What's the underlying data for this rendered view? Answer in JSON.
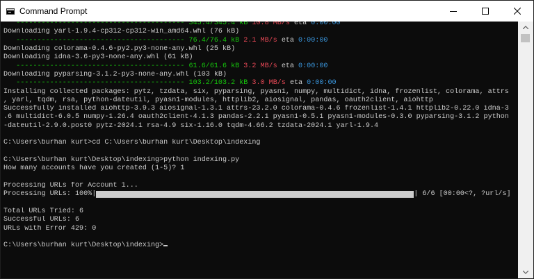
{
  "window": {
    "title": "Command Prompt",
    "icon": "terminal-icon",
    "controls": [
      "minimize-icon",
      "maximize-icon",
      "close-icon"
    ]
  },
  "colors": {
    "background": "#0c0c0c",
    "text": "#cccccc",
    "progress_green": "#16c60c",
    "speed_red": "#e74856",
    "eta_cyan": "#3a96dd"
  },
  "console": {
    "lines": [
      {
        "kind": "progress",
        "bar": "---------------------------------------- ",
        "amount": "345.4/345.4 kB",
        "speed": "10.8 MB/s",
        "eta_label": "eta",
        "eta": "0:00:00"
      },
      {
        "kind": "text",
        "text": "Downloading yarl-1.9.4-cp312-cp312-win_amd64.whl (76 kB)"
      },
      {
        "kind": "progress",
        "bar": "---------------------------------------- ",
        "amount": "76.4/76.4 kB",
        "speed": "2.1 MB/s",
        "eta_label": "eta",
        "eta": "0:00:00"
      },
      {
        "kind": "text",
        "text": "Downloading colorama-0.4.6-py2.py3-none-any.whl (25 kB)"
      },
      {
        "kind": "text",
        "text": "Downloading idna-3.6-py3-none-any.whl (61 kB)"
      },
      {
        "kind": "progress",
        "bar": "---------------------------------------- ",
        "amount": "61.6/61.6 kB",
        "speed": "3.2 MB/s",
        "eta_label": "eta",
        "eta": "0:00:00"
      },
      {
        "kind": "text",
        "text": "Downloading pyparsing-3.1.2-py3-none-any.whl (103 kB)"
      },
      {
        "kind": "progress",
        "bar": "---------------------------------------- ",
        "amount": "103.2/103.2 kB",
        "speed": "3.0 MB/s",
        "eta_label": "eta",
        "eta": "0:00:00"
      },
      {
        "kind": "text",
        "text": "Installing collected packages: pytz, tzdata, six, pyparsing, pyasn1, numpy, multidict, idna, frozenlist, colorama, attrs"
      },
      {
        "kind": "text",
        "text": ", yarl, tqdm, rsa, python-dateutil, pyasn1-modules, httplib2, aiosignal, pandas, oauth2client, aiohttp"
      },
      {
        "kind": "text",
        "text": "Successfully installed aiohttp-3.9.3 aiosignal-1.3.1 attrs-23.2.0 colorama-0.4.6 frozenlist-1.4.1 httplib2-0.22.0 idna-3"
      },
      {
        "kind": "text",
        "text": ".6 multidict-6.0.5 numpy-1.26.4 oauth2client-4.1.3 pandas-2.2.1 pyasn1-0.5.1 pyasn1-modules-0.3.0 pyparsing-3.1.2 python"
      },
      {
        "kind": "text",
        "text": "-dateutil-2.9.0.post0 pytz-2024.1 rsa-4.9 six-1.16.0 tqdm-4.66.2 tzdata-2024.1 yarl-1.9.4"
      },
      {
        "kind": "text",
        "text": ""
      },
      {
        "kind": "text",
        "text": "C:\\Users\\burhan kurt>cd C:\\Users\\burhan kurt\\Desktop\\indexing"
      },
      {
        "kind": "text",
        "text": ""
      },
      {
        "kind": "text",
        "text": "C:\\Users\\burhan kurt\\Desktop\\indexing>python indexing.py"
      },
      {
        "kind": "text",
        "text": "How many accounts have you created (1-5)? 1"
      },
      {
        "kind": "text",
        "text": ""
      },
      {
        "kind": "text",
        "text": "Processing URLs for Account 1..."
      },
      {
        "kind": "bar",
        "label": "Processing URLs: 100%|",
        "fraction": 1.0,
        "suffix": "| 6/6 [00:00<?, ?url/s]"
      },
      {
        "kind": "text",
        "text": ""
      },
      {
        "kind": "text",
        "text": "Total URLs Tried: 6"
      },
      {
        "kind": "text",
        "text": "Successful URLs: 6"
      },
      {
        "kind": "text",
        "text": "URLs with Error 429: 0"
      },
      {
        "kind": "text",
        "text": ""
      },
      {
        "kind": "prompt",
        "text": "C:\\Users\\burhan kurt\\Desktop\\indexing>"
      }
    ]
  },
  "scrollbar": {
    "up_icon": "scroll-up-arrow-icon",
    "down_icon": "scroll-down-arrow-icon"
  }
}
